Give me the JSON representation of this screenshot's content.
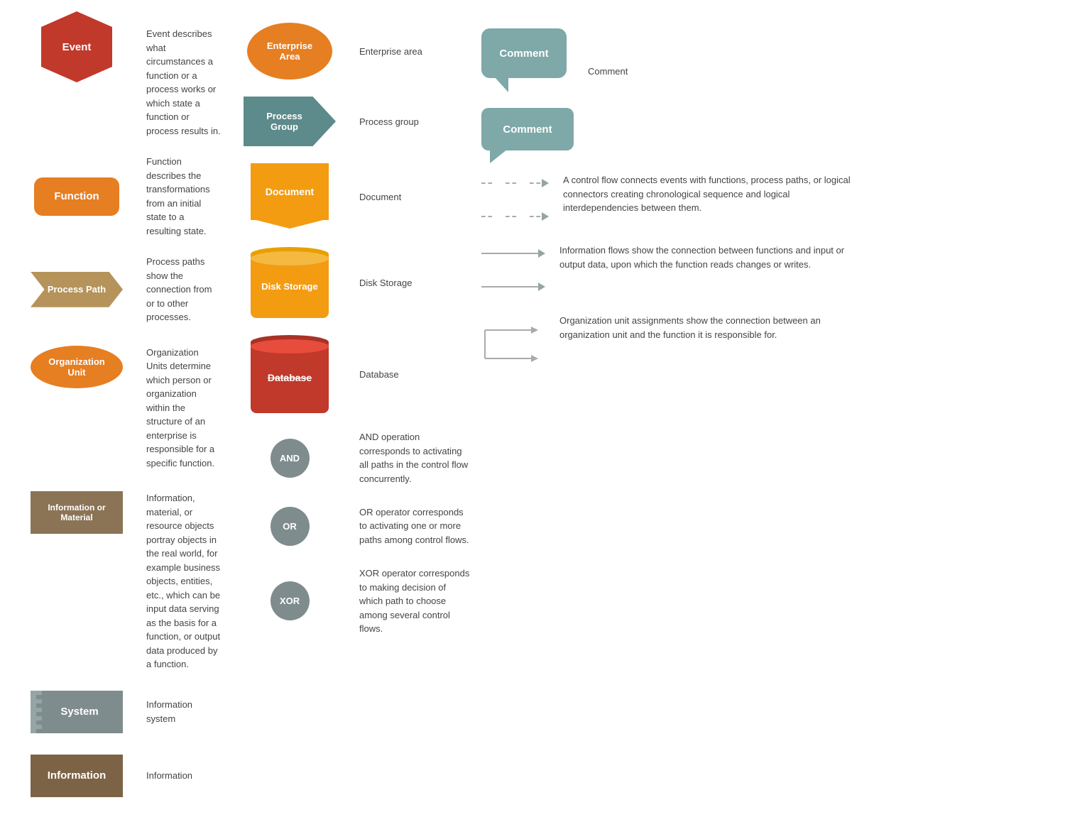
{
  "col1": {
    "items": [
      {
        "shape": "hexagon",
        "label": "Event",
        "desc": "Event describes what circumstances a function or a process works or which state a function or process results in."
      },
      {
        "shape": "rounded-rect",
        "label": "Function",
        "desc": "Function describes the transformations from an initial state to a resulting state."
      },
      {
        "shape": "process-path",
        "label": "Process Path",
        "desc": "Process paths show the connection from or to other processes."
      },
      {
        "shape": "org-unit",
        "label": "Organization Unit",
        "desc": "Organization Units determine which person or organization within the structure of an enterprise is responsible for a specific function."
      },
      {
        "shape": "info-material",
        "label": "Information or Material",
        "desc": "Information, material, or resource objects portray objects in the real world, for example business objects, entities, etc., which can be input data serving as the basis for a function, or output data produced by a function."
      },
      {
        "shape": "system",
        "label": "System",
        "desc": "Information system"
      },
      {
        "shape": "info-box",
        "label": "Information",
        "desc": "Information"
      }
    ]
  },
  "col2": {
    "items": [
      {
        "shape": "enterprise-area",
        "label": "Enterprise Area",
        "desc": "Enterprise area"
      },
      {
        "shape": "process-group",
        "label": "Process Group",
        "desc": "Process group"
      },
      {
        "shape": "document",
        "label": "Document",
        "desc": "Document"
      },
      {
        "shape": "disk-storage",
        "label": "Disk Storage",
        "desc": "Disk Storage"
      },
      {
        "shape": "database",
        "label": "Database",
        "desc": "Database"
      },
      {
        "shape": "and-circle",
        "label": "AND",
        "desc": "AND operation corresponds to activating all paths in the control flow concurrently."
      },
      {
        "shape": "or-circle",
        "label": "OR",
        "desc": "OR operator corresponds to activating one or more paths among control flows."
      },
      {
        "shape": "xor-circle",
        "label": "XOR",
        "desc": "XOR operator corresponds to making decision of which path to choose among several control flows."
      }
    ]
  },
  "col3": {
    "items": [
      {
        "shape": "comment-bubble1",
        "label": "Comment",
        "desc": "Comment"
      },
      {
        "shape": "comment-bubble2",
        "label": "Comment",
        "desc": ""
      },
      {
        "shape": "dashed-arrows",
        "label": "",
        "desc": "A control flow connects events with functions, process paths, or logical connectors creating chronological sequence and logical interdependencies between them."
      },
      {
        "shape": "solid-arrows",
        "label": "",
        "desc": "Information flows show the connection between functions and input or output data, upon which the function reads changes or writes."
      },
      {
        "shape": "org-connector",
        "label": "",
        "desc": "Organization unit assignments show the connection between an organization unit and the function it is responsible for."
      }
    ]
  }
}
